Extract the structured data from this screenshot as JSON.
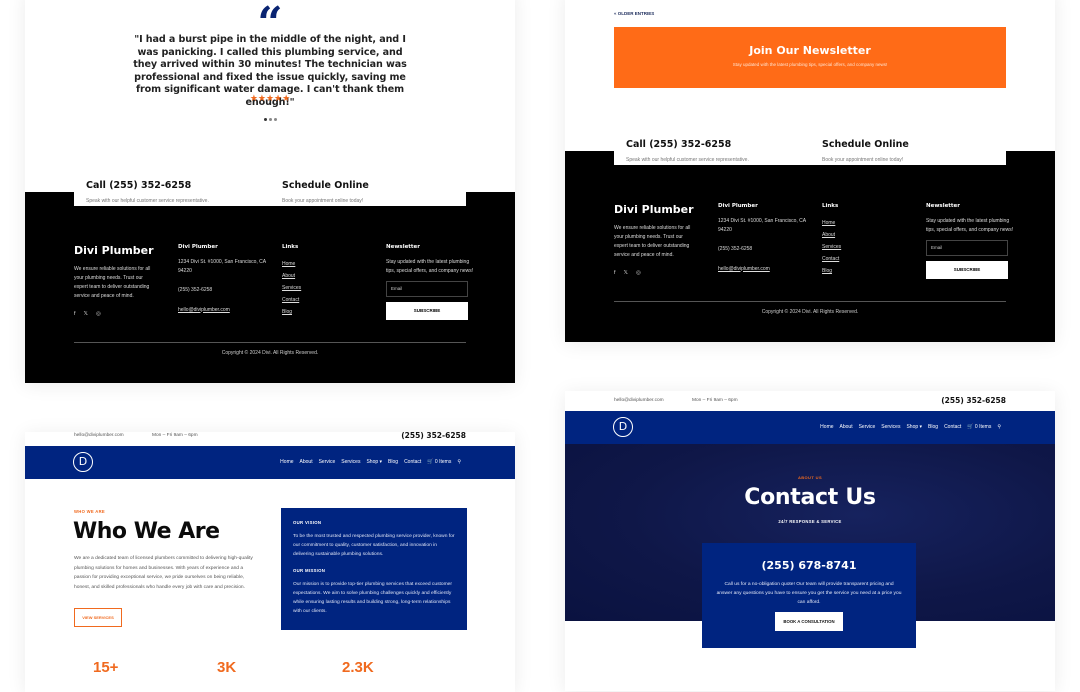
{
  "colors": {
    "brand_navy": "#002480",
    "accent_orange": "#f06a1f",
    "newsletter_orange": "#ff6b17",
    "footer_black": "#000000"
  },
  "testimonial": {
    "quote_icon": "quote-icon",
    "text": "\"I had a burst pipe in the middle of the night, and I was panicking. I called this plumbing service, and they arrived within 30 minutes! The technician was professional and fixed the issue quickly, saving me from significant water damage. I can't thank them enough!\"",
    "stars": "★★★★★",
    "rating": 5,
    "slide_count": 3,
    "active_slide": 1
  },
  "cta": {
    "call_title": "Call (255) 352-6258",
    "call_sub": "Speak with our helpful customer service representative.",
    "schedule_title": "Schedule Online",
    "schedule_sub": "Book your appointment online today!"
  },
  "footer": {
    "brand": "Divi Plumber",
    "brand_desc": "We ensure reliable solutions for all your plumbing needs. Trust our expert team to deliver outstanding service and peace of mind.",
    "social": [
      "f",
      "𝕏",
      "◎"
    ],
    "contact_title": "Divi Plumber",
    "address": "1234 Divi St. #1000, San Francisco, CA 94220",
    "phone": "(255) 352-6258",
    "email": "hello@diviplumber.com",
    "links_title": "Links",
    "links": [
      "Home",
      "About",
      "Services",
      "Contact",
      "Blog"
    ],
    "newsletter_title": "Newsletter",
    "newsletter_desc": "Stay updated with the latest plumbing tips, special offers, and company news!",
    "email_placeholder": "Email",
    "subscribe_label": "SUBSCRIBE",
    "copyright": "Copyright © 2024 Divi. All Rights Reserved."
  },
  "blog_page": {
    "older_entries": "« OLDER ENTRIES",
    "newsletter_banner_title": "Join Our Newsletter",
    "newsletter_banner_sub": "Stay updated with the latest plumbing tips, special offers, and company news!"
  },
  "header": {
    "email": "hello@diviplumber.com",
    "hours": "Mon – Fri 9am – 6pm",
    "phone": "(255) 352-6258",
    "logo": "D",
    "nav": [
      "Home",
      "About",
      "Service",
      "Services",
      "Shop ▾",
      "Blog",
      "Contact"
    ],
    "cart": "0 Items"
  },
  "about_page": {
    "eyebrow": "WHO WE ARE",
    "title": "Who We Are",
    "body": "We are a dedicated team of licensed plumbers committed to delivering high-quality plumbing solutions for homes and businesses. With years of experience and a passion for providing exceptional service, we pride ourselves on being reliable, honest, and skilled professionals who handle every job with care and precision.",
    "button": "VIEW SERVICES",
    "vision_title": "OUR VISION",
    "vision_text": "To be the most trusted and respected plumbing service provider, known for our commitment to quality, customer satisfaction, and innovation in delivering sustainable plumbing solutions.",
    "mission_title": "OUR MISSION",
    "mission_text": "Our mission is to provide top-tier plumbing services that exceed customer expectations. We aim to solve plumbing challenges quickly and efficiently while ensuring lasting results and building strong, long-term relationships with our clients.",
    "stats": [
      "15+",
      "3K",
      "2.3K"
    ]
  },
  "contact_page": {
    "eyebrow": "ABOUT US",
    "title": "Contact Us",
    "subtitle": "24/7 RESPONSE & SERVICE",
    "phone": "(255) 678-8741",
    "text": "Call us for a no-obligation quote! Our team will provide transparent pricing and answer any questions you have to ensure you get the service you need at a price you can afford.",
    "button": "BOOK A CONSULTATION"
  }
}
